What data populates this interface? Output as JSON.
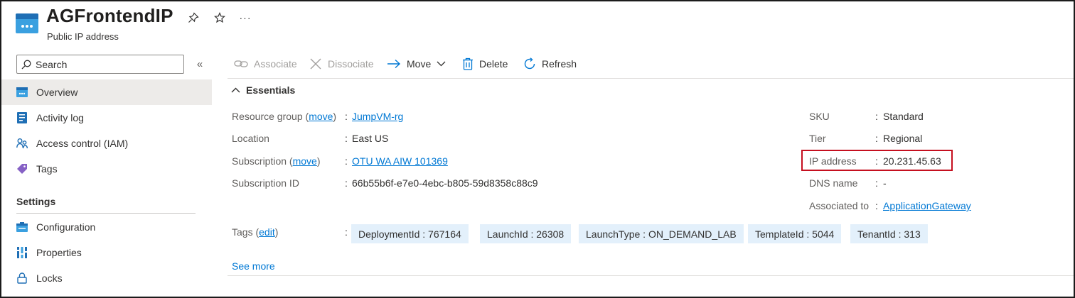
{
  "header": {
    "title": "AGFrontendIP",
    "subtitle": "Public IP address",
    "icon": "public-ip-icon",
    "actions": [
      "pin-icon",
      "star-icon",
      "more-icon"
    ],
    "more_label": "···"
  },
  "sidebar": {
    "search_placeholder": "Search",
    "collapse_label": "«",
    "items": [
      {
        "label": "Overview",
        "icon": "overview-icon",
        "active": true
      },
      {
        "label": "Activity log",
        "icon": "activity-log-icon"
      },
      {
        "label": "Access control (IAM)",
        "icon": "iam-icon"
      },
      {
        "label": "Tags",
        "icon": "tag-icon"
      }
    ],
    "section_settings": "Settings",
    "settings_items": [
      {
        "label": "Configuration",
        "icon": "configuration-icon"
      },
      {
        "label": "Properties",
        "icon": "properties-icon"
      },
      {
        "label": "Locks",
        "icon": "lock-icon"
      }
    ]
  },
  "toolbar": {
    "associate": "Associate",
    "dissociate": "Dissociate",
    "move": "Move",
    "delete": "Delete",
    "refresh": "Refresh"
  },
  "essentials": {
    "heading": "Essentials",
    "left": {
      "resource_group_label": "Resource group",
      "move_link": "move",
      "resource_group_value": "JumpVM-rg",
      "location_label": "Location",
      "location_value": "East US",
      "subscription_label": "Subscription",
      "subscription_value": "OTU WA AIW 101369",
      "subscription_id_label": "Subscription ID",
      "subscription_id_value": "66b55b6f-e7e0-4ebc-b805-59d8358c88c9"
    },
    "right": {
      "sku_label": "SKU",
      "sku_value": "Standard",
      "tier_label": "Tier",
      "tier_value": "Regional",
      "ip_label": "IP address",
      "ip_value": "20.231.45.63",
      "dns_label": "DNS name",
      "dns_value": "-",
      "associated_label": "Associated to",
      "associated_value": "ApplicationGateway"
    },
    "tags_label": "Tags",
    "edit_link": "edit",
    "tags": [
      "DeploymentId : 767164",
      "LaunchId : 26308",
      "LaunchType : ON_DEMAND_LAB",
      "TemplateId : 5044",
      "TenantId : 313"
    ],
    "see_more": "See more"
  },
  "colors": {
    "link": "#0078d4",
    "highlight_border": "#c50f1f",
    "tag_bg": "#e3f0fb",
    "active_nav_bg": "#edebe9"
  }
}
